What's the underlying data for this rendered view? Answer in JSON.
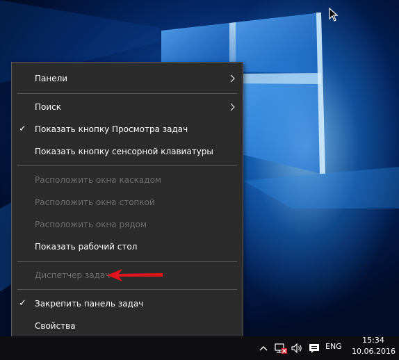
{
  "context_menu": {
    "items": [
      {
        "label": "Панели",
        "checked": false,
        "disabled": false,
        "submenu": true
      },
      {
        "label": "Поиск",
        "checked": false,
        "disabled": false,
        "submenu": true
      },
      {
        "label": "Показать кнопку Просмотра задач",
        "checked": true,
        "disabled": false,
        "submenu": false
      },
      {
        "label": "Показать кнопку сенсорной клавиатуры",
        "checked": false,
        "disabled": false,
        "submenu": false
      },
      {
        "label": "Расположить окна каскадом",
        "checked": false,
        "disabled": true,
        "submenu": false
      },
      {
        "label": "Расположить окна стопкой",
        "checked": false,
        "disabled": true,
        "submenu": false
      },
      {
        "label": "Расположить окна рядом",
        "checked": false,
        "disabled": true,
        "submenu": false
      },
      {
        "label": "Показать рабочий стол",
        "checked": false,
        "disabled": false,
        "submenu": false
      },
      {
        "label": "Диспетчер задач",
        "checked": false,
        "disabled": true,
        "submenu": false
      },
      {
        "label": "Закрепить панель задач",
        "checked": true,
        "disabled": false,
        "submenu": false
      },
      {
        "label": "Свойства",
        "checked": false,
        "disabled": false,
        "submenu": false
      }
    ],
    "check_glyph": "✓"
  },
  "taskbar": {
    "tray_icons": [
      "chevron-up-icon",
      "network-icon",
      "volume-icon",
      "action-center-icon"
    ],
    "language": "ENG",
    "time": "15:34",
    "date": "10.06.2016"
  },
  "colors": {
    "menu_background": "#2b2b2b",
    "disabled_text": "#6d6d6d",
    "annotation_arrow": "#e0141c",
    "taskbar": "#0e0e10"
  }
}
